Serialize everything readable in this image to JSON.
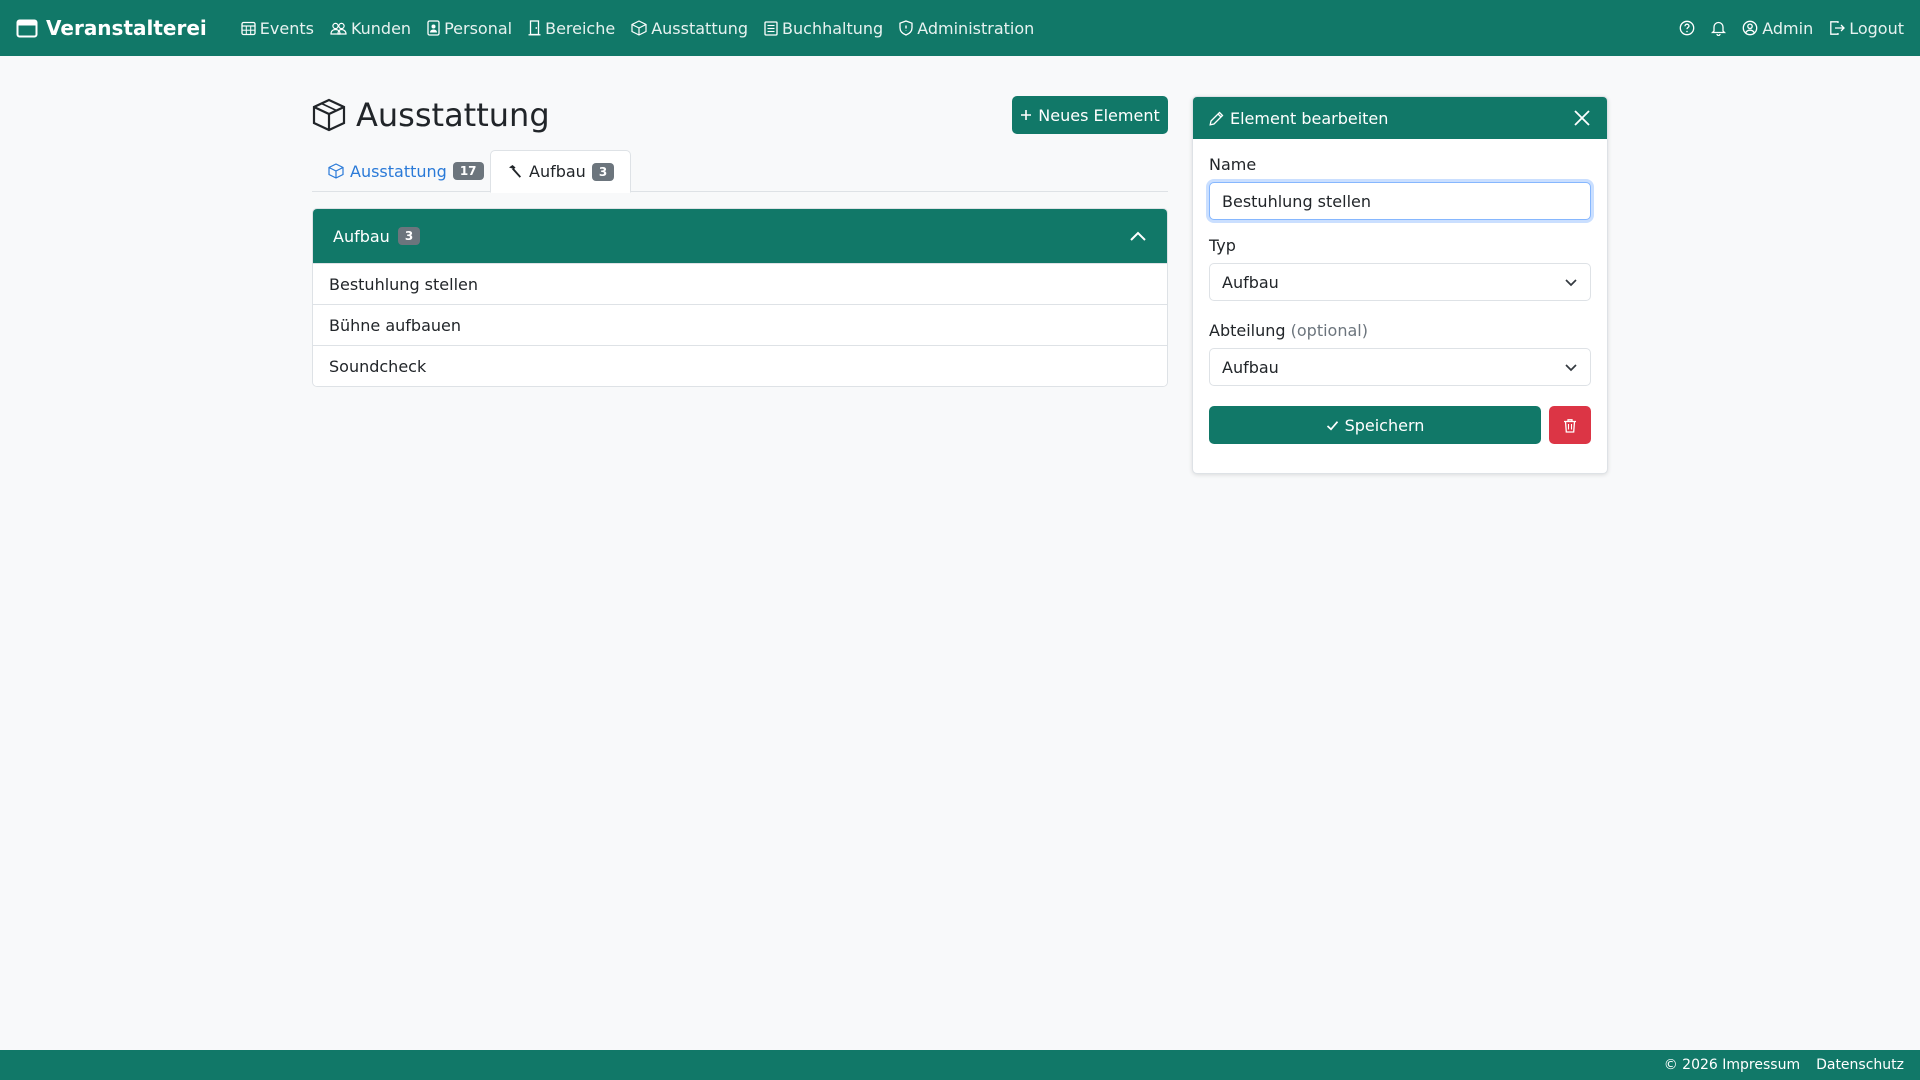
{
  "app": {
    "brand": "Veranstalterei"
  },
  "nav": {
    "items": [
      {
        "label": "Events",
        "icon": "calendar-table-icon"
      },
      {
        "label": "Kunden",
        "icon": "people-icon"
      },
      {
        "label": "Personal",
        "icon": "person-badge-icon"
      },
      {
        "label": "Bereiche",
        "icon": "door-icon"
      },
      {
        "label": "Ausstattung",
        "icon": "box-icon"
      },
      {
        "label": "Buchhaltung",
        "icon": "journal-icon"
      },
      {
        "label": "Administration",
        "icon": "shield-icon"
      }
    ],
    "right": {
      "user": "Admin",
      "logout": "Logout"
    }
  },
  "page": {
    "title": "Ausstattung",
    "new_button": "Neues Element"
  },
  "tabs": [
    {
      "label": "Ausstattung",
      "count": "17",
      "active": false
    },
    {
      "label": "Aufbau",
      "count": "3",
      "active": true
    }
  ],
  "group": {
    "title": "Aufbau",
    "count": "3",
    "items": [
      "Bestuhlung stellen",
      "Bühne aufbauen",
      "Soundcheck"
    ]
  },
  "edit": {
    "title": "Element bearbeiten",
    "name_label": "Name",
    "name_value": "Bestuhlung stellen",
    "type_label": "Typ",
    "type_value": "Aufbau",
    "dept_label": "Abteilung",
    "dept_optional": "(optional)",
    "dept_value": "Aufbau",
    "save_label": "Speichern"
  },
  "footer": {
    "copyright": "© 2026 Impressum",
    "privacy": "Datenschutz"
  },
  "colors": {
    "primary": "#117868",
    "danger": "#dc3545",
    "link": "#2a7ad8"
  }
}
